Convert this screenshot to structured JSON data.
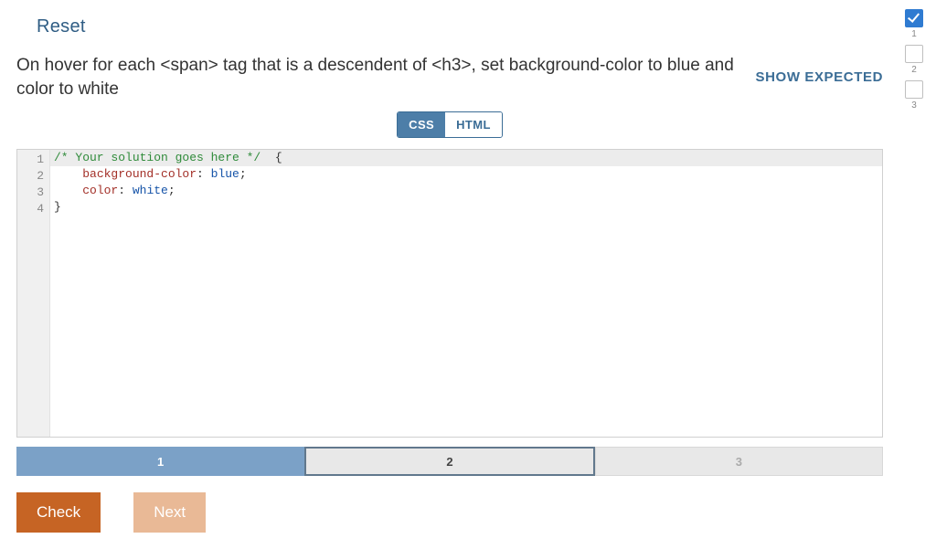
{
  "reset_label": "Reset",
  "prompt": "On hover for each <span> tag that is a descendent of <h3>, set background-color to blue and color to white",
  "show_expected_label": "SHOW EXPECTED",
  "tabs": {
    "css": "CSS",
    "html": "HTML",
    "active": "css"
  },
  "code": {
    "line1_comment": "/* Your solution goes here */",
    "line1_brace": "  {",
    "line2_indent": "    ",
    "line2_prop": "background-color",
    "line2_colon": ": ",
    "line2_value": "blue",
    "line2_semi": ";",
    "line3_indent": "    ",
    "line3_prop": "color",
    "line3_colon": ": ",
    "line3_value": "white",
    "line3_semi": ";",
    "line4": "}"
  },
  "gutter": [
    "1",
    "2",
    "3",
    "4"
  ],
  "progress": {
    "seg1": "1",
    "seg2": "2",
    "seg3": "3",
    "current": 2
  },
  "buttons": {
    "check": "Check",
    "next": "Next"
  },
  "sidebar": [
    {
      "num": "1",
      "checked": true
    },
    {
      "num": "2",
      "checked": false
    },
    {
      "num": "3",
      "checked": false
    }
  ]
}
